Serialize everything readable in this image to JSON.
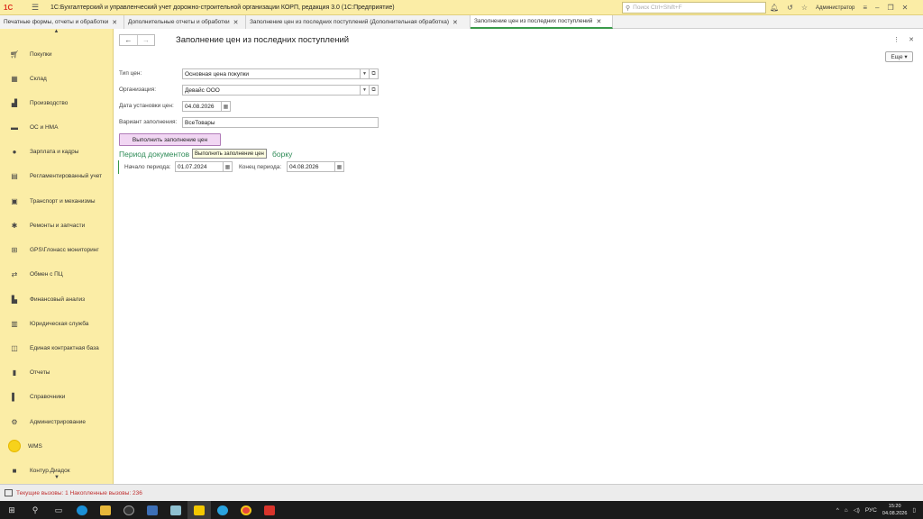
{
  "window": {
    "title": "1С:Бухгалтерский и управленческий учет дорожно-строительной организации КОРП, редакция 3.0  (1С:Предприятие)",
    "search_placeholder": "Поиск Ctrl+Shift+F",
    "user": "Администратор"
  },
  "tabs": [
    {
      "label": "Печатные формы, отчеты и обработки"
    },
    {
      "label": "Дополнительные отчеты и обработки"
    },
    {
      "label": "Заполнение цен из последних поступлений (Дополнительная обработка)"
    },
    {
      "label": "Заполнение цен из последних поступлений"
    }
  ],
  "sidebar": {
    "items": [
      {
        "label": "Покупки",
        "icon": "cart-icon"
      },
      {
        "label": "Склад",
        "icon": "warehouse-icon"
      },
      {
        "label": "Производство",
        "icon": "factory-icon"
      },
      {
        "label": "ОС и НМА",
        "icon": "truck-icon"
      },
      {
        "label": "Зарплата и кадры",
        "icon": "person-icon"
      },
      {
        "label": "Регламентированный учет",
        "icon": "document-icon"
      },
      {
        "label": "Транспорт и механизмы",
        "icon": "bus-icon"
      },
      {
        "label": "Ремонты и запчасти",
        "icon": "wrench-icon"
      },
      {
        "label": "GPS\\Глонасс мониторинг",
        "icon": "satellite-icon"
      },
      {
        "label": "Обмен с ПЦ",
        "icon": "exchange-icon"
      },
      {
        "label": "Финансовый анализ",
        "icon": "chart-icon"
      },
      {
        "label": "Юридическая служба",
        "icon": "legal-icon"
      },
      {
        "label": "Единая контрактная база",
        "icon": "book-icon"
      },
      {
        "label": "Отчеты",
        "icon": "bar-chart-icon"
      },
      {
        "label": "Справочники",
        "icon": "books-icon"
      },
      {
        "label": "Администрирование",
        "icon": "gear-icon"
      },
      {
        "label": "WMS",
        "icon": "wms-circle-icon"
      },
      {
        "label": "Контур.Диадок",
        "icon": "diadoc-icon"
      }
    ]
  },
  "form": {
    "title": "Заполнение цен из последних поступлений",
    "more_label": "Еще",
    "price_type_label": "Тип цен:",
    "price_type_value": "Основная цена покупки",
    "org_label": "Организация:",
    "org_value": "Девайс ООО",
    "date_label": "Дата установки цен:",
    "date_value": "04.08.2026",
    "variant_label": "Вариант заполнения:",
    "variant_value": "ВсеТовары",
    "run_button": "Выполнить заполнение цен",
    "tooltip": "Выполнить заполнение цен",
    "group_title": "Период документов",
    "group_title_tail": "борку",
    "start_label": "Начало периода:",
    "start_value": "01.07.2024",
    "end_label": "Конец периода:",
    "end_value": "04.08.2026"
  },
  "status": {
    "text": "Текущие вызовы: 1   Накопленные вызовы: 236"
  },
  "taskbar": {
    "lang": "РУС",
    "time": "15:20",
    "date": "04.08.2026"
  }
}
